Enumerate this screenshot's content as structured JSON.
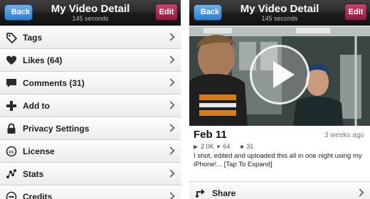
{
  "left_screen": {
    "nav": {
      "back": "Back",
      "title": "My Video Detail",
      "subtitle": "145 seconds",
      "edit": "Edit"
    },
    "menu": [
      {
        "label": "Tags",
        "icon": "tag-icon"
      },
      {
        "label": "Likes (64)",
        "icon": "heart-icon"
      },
      {
        "label": "Comments (31)",
        "icon": "comment-icon"
      },
      {
        "label": "Add to",
        "icon": "plus-icon"
      },
      {
        "label": "Privacy Settings",
        "icon": "lock-icon"
      },
      {
        "label": "License",
        "icon": "creative-commons-icon"
      },
      {
        "label": "Stats",
        "icon": "stats-icon"
      },
      {
        "label": "Credits",
        "icon": "credits-icon"
      }
    ]
  },
  "right_screen": {
    "nav": {
      "back": "Back",
      "title": "My Video Detail",
      "subtitle": "145 seconds",
      "edit": "Edit"
    },
    "video": {
      "title": "Feb 11",
      "age": "3 weeks ago",
      "plays": "2.0K",
      "likes": "64",
      "comments": "31",
      "description": "I shot, edited and uploaded this all in one night using my iPhone!... [Tap To Expand]"
    },
    "share": {
      "label": "Share",
      "icon": "share-icon"
    }
  }
}
